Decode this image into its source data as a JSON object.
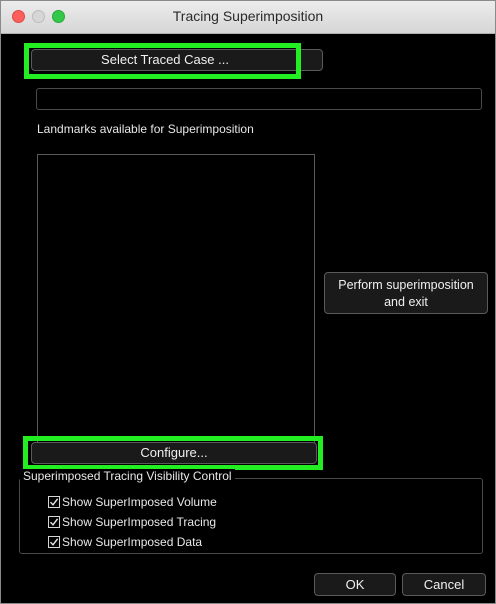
{
  "window": {
    "title": "Tracing Superimposition"
  },
  "select_traced_case_label": "Select Traced Case ...",
  "selected_case_value": "",
  "landmarks_label": "Landmarks available for Superimposition",
  "landmarks_list": [],
  "perform_button": {
    "line1": "Perform superimposition",
    "line2": "and exit"
  },
  "configure_label": "Configure...",
  "visibility_group": {
    "title": "Superimposed Tracing Visibility Control",
    "options": [
      {
        "label": "Show SuperImposed Volume",
        "checked": true
      },
      {
        "label": "Show SuperImposed Tracing",
        "checked": true
      },
      {
        "label": "Show SuperImposed Data",
        "checked": true
      }
    ]
  },
  "ok_label": "OK",
  "cancel_label": "Cancel",
  "highlight_color": "#22ee22"
}
